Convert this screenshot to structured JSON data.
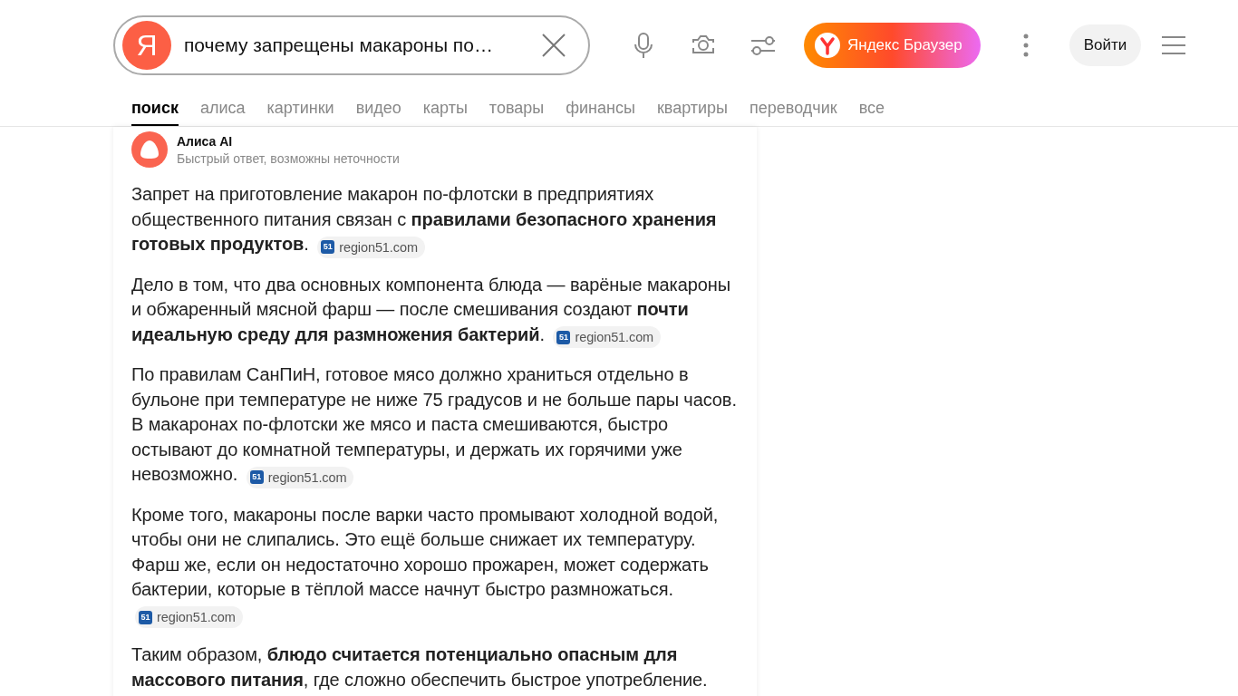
{
  "search": {
    "logo": "Я",
    "value": "почему запрещены макароны по…"
  },
  "browser_promo": {
    "label": "Яндекс Браузер"
  },
  "login_button": "Войти",
  "tabs": [
    {
      "label": "поиск",
      "selected": true
    },
    {
      "label": "алиса",
      "selected": false
    },
    {
      "label": "картинки",
      "selected": false
    },
    {
      "label": "видео",
      "selected": false
    },
    {
      "label": "карты",
      "selected": false
    },
    {
      "label": "товары",
      "selected": false
    },
    {
      "label": "финансы",
      "selected": false
    },
    {
      "label": "квартиры",
      "selected": false
    },
    {
      "label": "переводчик",
      "selected": false
    },
    {
      "label": "все",
      "selected": false
    }
  ],
  "answer": {
    "author": "Алиса AI",
    "subtitle": "Быстрый ответ, возможны неточности",
    "paragraphs": [
      {
        "text": "Запрет на приготовление макарон по-флотски в предприятиях общественного питания связан с **правилами безопасного хранения готовых продуктов**.",
        "source": {
          "badge": "51",
          "domain": "region51.com"
        }
      },
      {
        "text": "Дело в том, что два основных компонента блюда — варёные макароны и обжаренный мясной фарш — после смешивания создают **почти идеальную среду для размножения бактерий**.",
        "source": {
          "badge": "51",
          "domain": "region51.com"
        }
      },
      {
        "text": "По правилам СанПиН, готовое мясо должно храниться отдельно в бульоне при температуре не ниже 75 градусов и не больше пары часов. В макаронах по-флотски же мясо и паста смешиваются, быстро остывают до комнатной температуры, и держать их горячими уже невозможно.",
        "source": {
          "badge": "51",
          "domain": "region51.com"
        }
      },
      {
        "text": "Кроме того, макароны после варки часто промывают холодной водой, чтобы они не слипались. Это ещё больше снижает их температуру. Фарш же, если он недостаточно хорошо прожарен, может содержать бактерии, которые в тёплой массе начнут быстро размножаться.",
        "source": {
          "badge": "51",
          "domain": "region51.com"
        }
      },
      {
        "text": "Таким образом, **блюдо считается потенциально опасным для массового питания**, где сложно обеспечить быстрое употребление."
      }
    ]
  }
}
